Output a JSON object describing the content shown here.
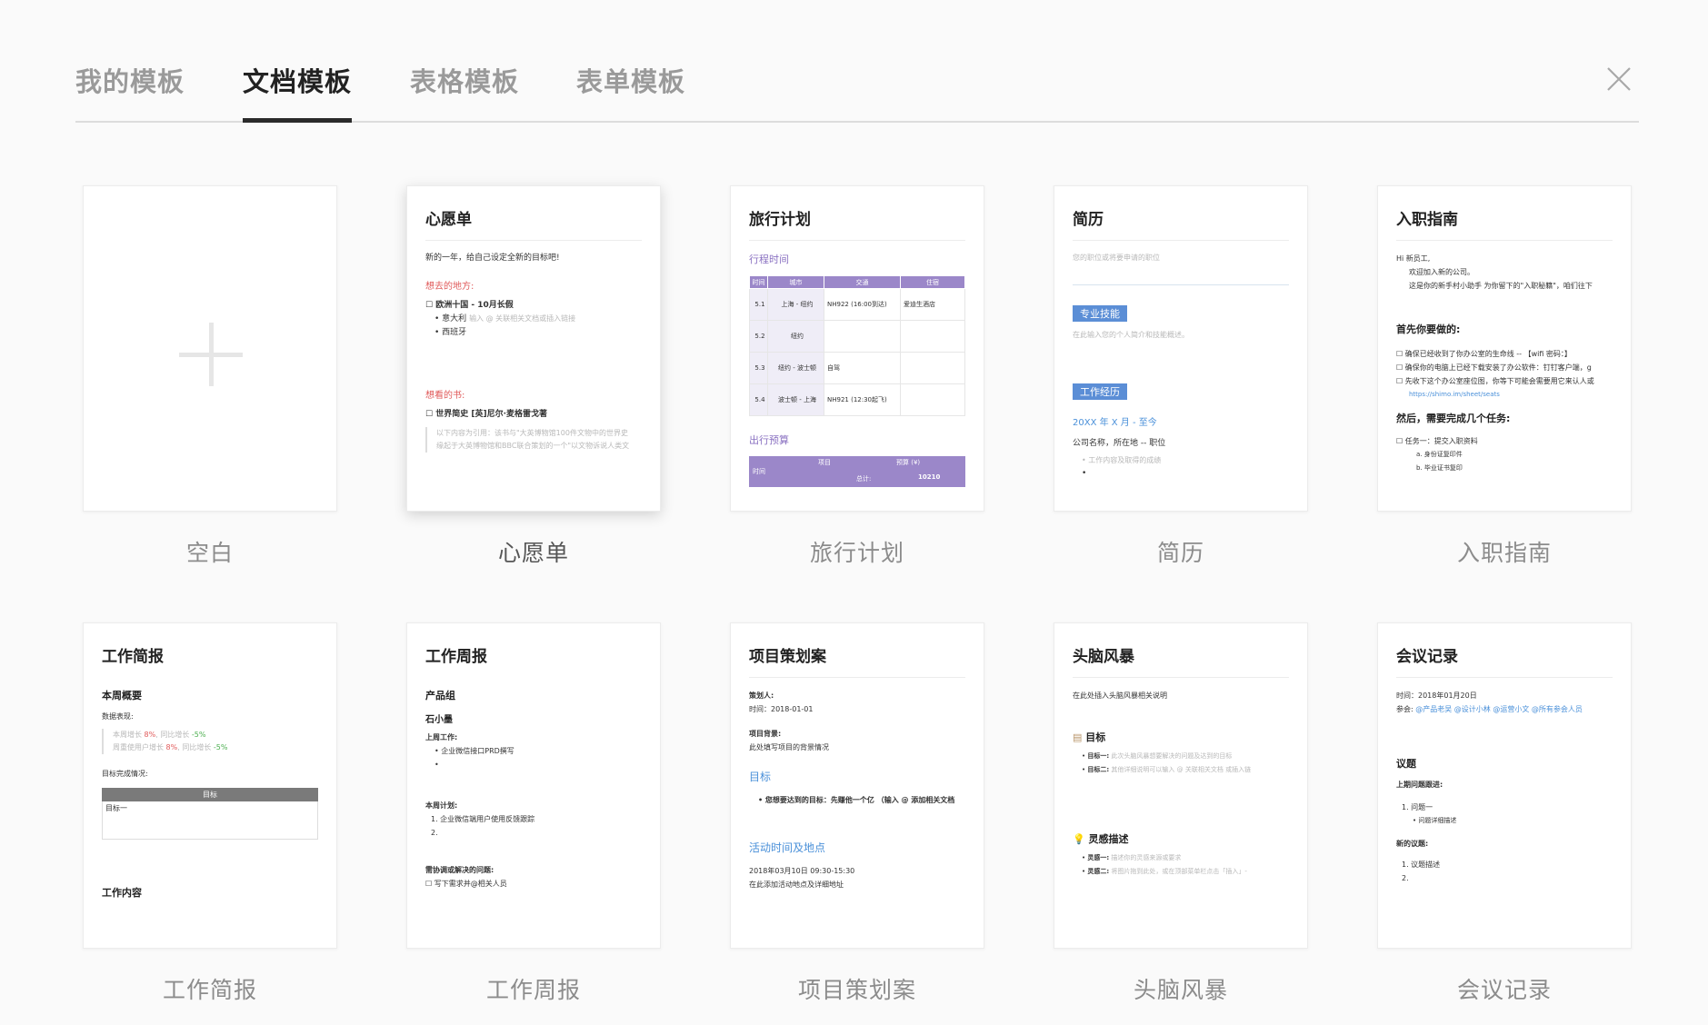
{
  "tabs": [
    "我的模板",
    "文档模板",
    "表格模板",
    "表单模板"
  ],
  "active_tab": 1,
  "templates": {
    "blank": "空白",
    "wishlist": "心愿单",
    "travel": "旅行计划",
    "resume": "简历",
    "onboarding": "入职指南",
    "brief": "工作简报",
    "weekly": "工作周报",
    "project": "项目策划案",
    "brainstorm": "头脑风暴",
    "meeting": "会议记录"
  },
  "wishlist_card": {
    "intro": "新的一年，给自己设定全新的目标吧!",
    "places_heading": "想去的地方:",
    "place_main": "欧洲十国 - 10月长假",
    "place_sub1": "意大利",
    "place_sub1_hint": "输入 @ 关联相关文档或插入链接",
    "place_sub2": "西班牙",
    "books_heading": "想看的书:",
    "book_main": "世界简史 [英]尼尔·麦格雷戈著",
    "quote1": "以下内容为引用：该书与\"大英博物馆100件文物中的世界史",
    "quote2": "缘起于大英博物馆和BBC联合策划的一个\"以文物诉说人类文"
  },
  "travel_card": {
    "time_heading": "行程时间",
    "headers": [
      "时间",
      "城市",
      "交通",
      "住宿"
    ],
    "rows": [
      [
        "5.1",
        "上海 - 纽约",
        "NH922 (16:00到达)",
        "爱迪生酒店"
      ],
      [
        "5.2",
        "纽约",
        "",
        ""
      ],
      [
        "5.3",
        "纽约 - 波士顿",
        "自驾",
        ""
      ],
      [
        "5.4",
        "波士顿 - 上海",
        "NH921 (12:30起飞)",
        ""
      ]
    ],
    "budget_heading": "出行预算",
    "budget_col1": "项目",
    "budget_col2": "预算 (¥)",
    "budget_row_label": "时间",
    "budget_total_label": "总计:",
    "budget_total": "10210"
  },
  "resume_card": {
    "placeholder": "您的职位或将要申请的职位",
    "skills_badge": "专业技能",
    "skills_hint": "在此输入您的个人简介和技能概述。",
    "experience_badge": "工作经历",
    "period": "20XX 年 X 月 - 至今",
    "company": "公司名称，所在地 -- 职位",
    "bullet_hint": "工作内容及取得的成绩"
  },
  "onboarding_card": {
    "greeting": "Hi 新员工,",
    "welcome": "欢迎加入新的公司。",
    "intro": "这是你的新手村小助手 为你留下的\"入职秘籍\"，咱们往下",
    "first_heading": "首先你要做的:",
    "task1": "确保已经收到了你办公室的生命线 -- 【wifi 密码：】",
    "task2": "确保你的电脑上已经下载安装了办公软件：钉钉客户端，g",
    "task3": "先收下这个办公室座位图，你等下可能会需要用它来认人或",
    "link": "https://shimo.im/sheet/seats",
    "then_heading": "然后，需要完成几个任务:",
    "task4": "任务一：提交入职资料",
    "sub_a": "a. 身份证复印件",
    "sub_b": "b. 毕业证书复印"
  },
  "brief_card": {
    "summary": "本周概要",
    "data_label": "数据表现:",
    "line1_a": "本周增长",
    "line1_b": "8%",
    "line1_c": "同比增长",
    "line1_d": "-5%",
    "line2_a": "周重使用户增长",
    "line2_b": "8%",
    "line2_c": "同比增长",
    "line2_d": "-5%",
    "goal_label": "目标完成情况:",
    "goal_header": "目标",
    "goal_row": "目标一",
    "content": "工作内容"
  },
  "weekly_card": {
    "group": "产品组",
    "person": "石小墨",
    "last_week": "上周工作:",
    "last_item": "企业微信接口PRD撰写",
    "plan": "本周计划:",
    "plan1": "1.  企业微信端用户使用反馈跟踪",
    "plan2": "2.",
    "issues": "需协调或解决的问题:",
    "issue1": "写下需求并@相关人员"
  },
  "project_card": {
    "planner": "策划人:",
    "time": "时间：2018-01-01",
    "bg_label": "项目背景:",
    "bg_text": "此处填写项目的背景情况",
    "goal_heading": "目标",
    "goal_text": "您想要达到的目标：先赚他一个亿 （输入 @ 添加相关文档",
    "venue_heading": "活动时间及地点",
    "venue_time": "2018年03月10日  09:30-15:30",
    "venue_text": "在此添加活动地点及详细地址"
  },
  "brainstorm_card": {
    "desc": "在此处插入头脑风暴相关说明",
    "goal_heading": "目标",
    "goal1_label": "目标一:",
    "goal1_hint": "此次头脑风暴想要解决的问题及达到的目标",
    "goal2_label": "目标二:",
    "goal2_hint": "其他详细说明可以输入 @ 关联相关文档 或插入链",
    "idea_heading": "灵感描述",
    "idea1_label": "灵感一:",
    "idea1_hint": "描述你的灵感来源或要求",
    "idea2_label": "灵感二:",
    "idea2_hint": "将图片拖到此处，或在顶部菜单栏点击「插入」-"
  },
  "meeting_card": {
    "time": "时间：2018年01月20日",
    "attendees_label": "参会:",
    "attendees": "@产品老吴 @设计小林 @运营小文 @所有参会人员",
    "agenda": "议题",
    "last_label": "上期问题跟进:",
    "last1": "1.  问题一",
    "last1_sub": "问题详细描述",
    "new_label": "新的议题:",
    "new1": "1.  议题描述",
    "new2": "2."
  },
  "colors": {
    "accent_purple": "#9b87c9",
    "accent_blue": "#4a90d9",
    "accent_red": "#e05a5a"
  }
}
